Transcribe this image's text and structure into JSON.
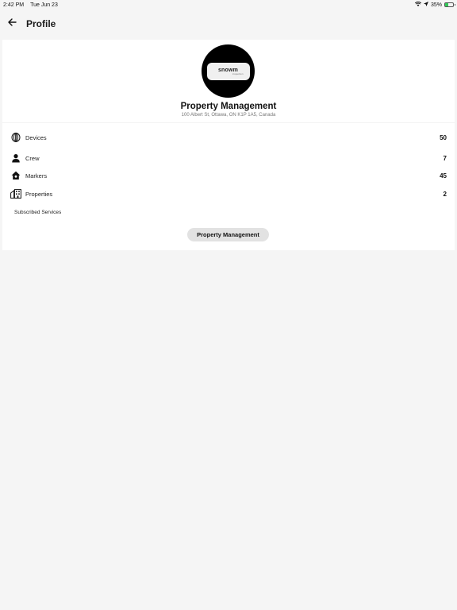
{
  "status_bar": {
    "time": "2:42 PM",
    "date": "Tue Jun 23",
    "battery": "35%",
    "battery_level": 0.35,
    "icons": [
      "wifi-icon",
      "location-icon",
      "battery-icon"
    ]
  },
  "header": {
    "title": "Profile",
    "back_icon": "arrow-left-icon"
  },
  "profile": {
    "logo_text": "snowm",
    "logo_subtext": "inspection",
    "name": "Property Management",
    "address": "100 Albert St, Ottawa, ON K1P 1A5, Canada"
  },
  "stats": [
    {
      "label": "Devices",
      "value": "50",
      "icon": "device-icon"
    },
    {
      "label": "Crew",
      "value": "7",
      "icon": "person-icon"
    },
    {
      "label": "Markers",
      "value": "45",
      "icon": "home-marker-icon"
    },
    {
      "label": "Properties",
      "value": "2",
      "icon": "building-icon"
    }
  ],
  "services": {
    "section_label": "Subscribed Services",
    "items": [
      "Property Management"
    ]
  },
  "colors": {
    "background": "#f5f5f5",
    "card": "#ffffff",
    "chip": "#e2e2e2",
    "battery": "#34c759"
  }
}
